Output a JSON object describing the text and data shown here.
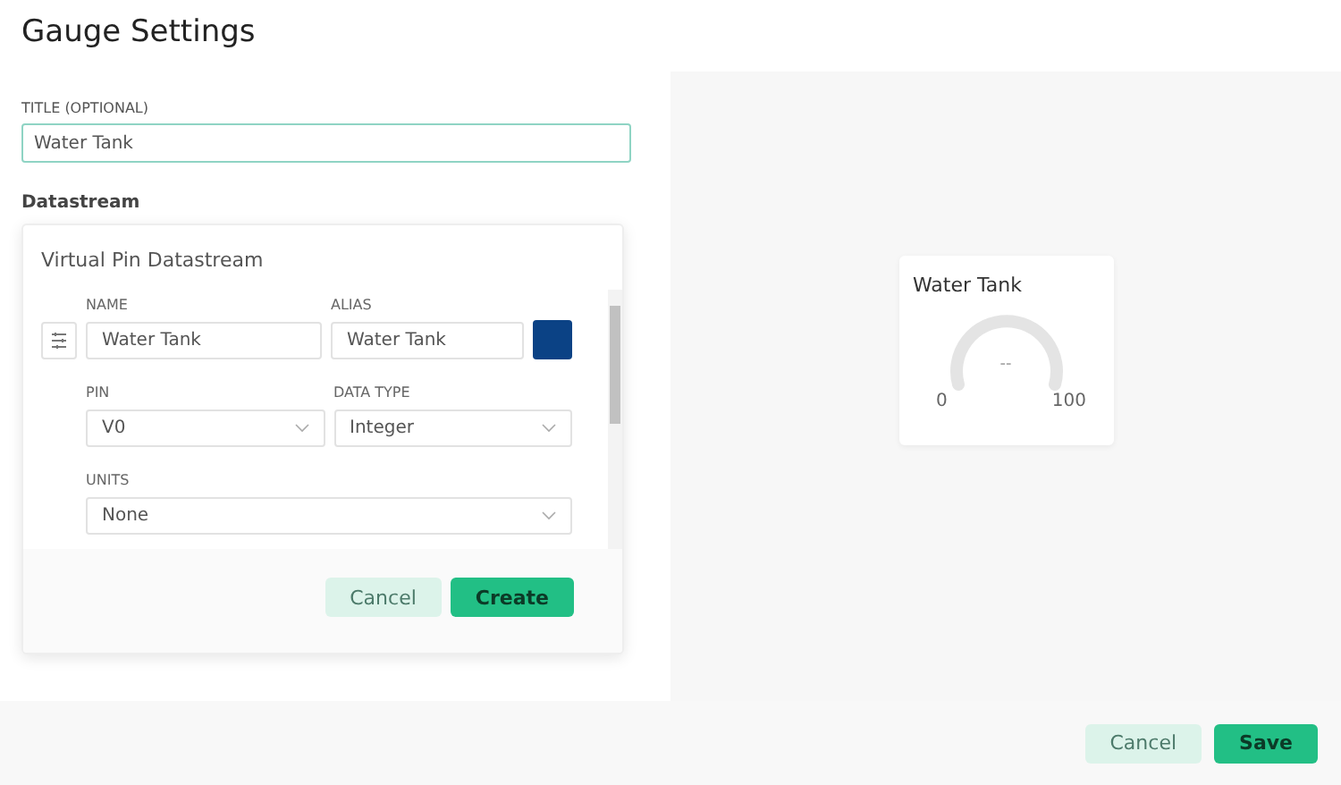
{
  "title": "Gauge Settings",
  "title_field": {
    "label": "TITLE (OPTIONAL)",
    "value": "Water Tank"
  },
  "datastream_heading": "Datastream",
  "dialog": {
    "title": "Virtual Pin Datastream",
    "name": {
      "label": "NAME",
      "value": "Water Tank"
    },
    "alias": {
      "label": "ALIAS",
      "value": "Water Tank",
      "color": "#0b4285"
    },
    "pin": {
      "label": "PIN",
      "value": "V0"
    },
    "data_type": {
      "label": "DATA TYPE",
      "value": "Integer"
    },
    "units": {
      "label": "UNITS",
      "value": "None"
    },
    "buttons": [
      {
        "label": "Cancel",
        "kind": "secondary"
      },
      {
        "label": "Create",
        "kind": "primary"
      }
    ]
  },
  "preview": {
    "title": "Water Tank",
    "value": "--",
    "min": "0",
    "max": "100"
  },
  "footer_buttons": [
    {
      "label": "Cancel",
      "kind": "secondary"
    },
    {
      "label": "Save",
      "kind": "primary"
    }
  ]
}
